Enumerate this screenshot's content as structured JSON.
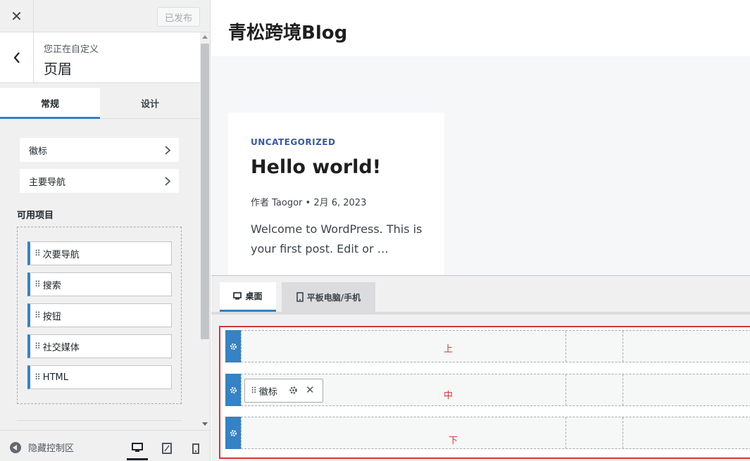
{
  "topbar": {
    "close_label": "✕",
    "publish_label": "已发布"
  },
  "section": {
    "subtitle": "您正在自定义",
    "title": "页眉"
  },
  "tabs": [
    {
      "label": "常规"
    },
    {
      "label": "设计"
    }
  ],
  "nav_cards": [
    {
      "label": "徽标"
    },
    {
      "label": "主要导航"
    }
  ],
  "available": {
    "title": "可用项目",
    "items": [
      {
        "label": "次要导航"
      },
      {
        "label": "搜索"
      },
      {
        "label": "按钮"
      },
      {
        "label": "社交媒体"
      },
      {
        "label": "HTML"
      }
    ]
  },
  "footer": {
    "hide_label": "隐藏控制区"
  },
  "preview": {
    "site_title": "青松跨境Blog",
    "post": {
      "category": "UNCATEGORIZED",
      "title": "Hello world!",
      "meta": "作者 Taogor  •  2月 6, 2023",
      "excerpt": "Welcome to WordPress. This is your first post. Edit or …"
    }
  },
  "builder": {
    "tabs": [
      {
        "label": "桌面"
      },
      {
        "label": "平板电脑/手机"
      }
    ],
    "rows": [
      {
        "label": "上"
      },
      {
        "label": "中"
      },
      {
        "label": "下"
      }
    ],
    "placed_item": "徽标"
  },
  "colors": {
    "accent": "#3582c4",
    "highlight": "#d63638"
  }
}
